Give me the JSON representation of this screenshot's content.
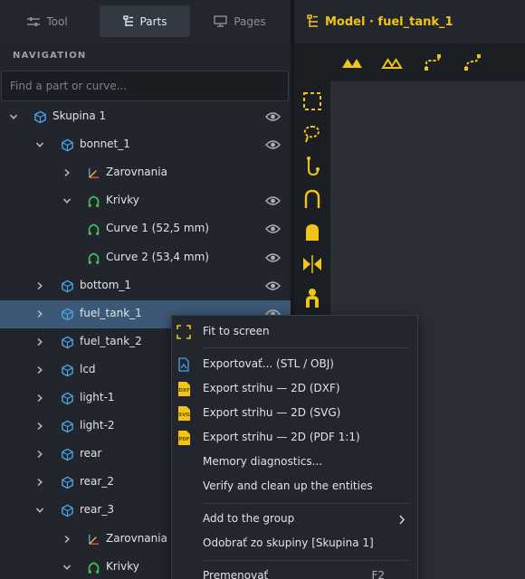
{
  "tabs": [
    {
      "label": "Tool",
      "icon": "sliders-icon"
    },
    {
      "label": "Parts",
      "icon": "list-icon",
      "active": true
    },
    {
      "label": "Pages",
      "icon": "monitor-icon"
    }
  ],
  "navigation": {
    "title": "NAVIGATION",
    "search_placeholder": "Find a part or curve..."
  },
  "tree": [
    {
      "label": "Skupina 1",
      "icon": "part-icon",
      "chevron": "down",
      "eye": true
    },
    {
      "label": "bonnet_1",
      "icon": "part-icon",
      "chevron": "down",
      "eye": true
    },
    {
      "label": "Zarovnania",
      "icon": "axes-icon",
      "chevron": "right",
      "eye": false
    },
    {
      "label": "Krivky",
      "icon": "curve-icon",
      "chevron": "down",
      "eye": true
    },
    {
      "label": "Curve 1  (52,5 mm)",
      "icon": "curve-icon",
      "chevron": "",
      "eye": true
    },
    {
      "label": "Curve 2  (53,4 mm)",
      "icon": "curve-icon",
      "chevron": "",
      "eye": true
    },
    {
      "label": "bottom_1",
      "icon": "part-icon",
      "chevron": "right",
      "eye": true
    },
    {
      "label": "fuel_tank_1",
      "icon": "part-icon",
      "chevron": "right",
      "eye": true,
      "selected": true
    },
    {
      "label": "fuel_tank_2",
      "icon": "part-icon",
      "chevron": "right",
      "eye": false
    },
    {
      "label": "lcd",
      "icon": "part-icon",
      "chevron": "right",
      "eye": false
    },
    {
      "label": "light-1",
      "icon": "part-icon",
      "chevron": "right",
      "eye": false
    },
    {
      "label": "light-2",
      "icon": "part-icon",
      "chevron": "right",
      "eye": false
    },
    {
      "label": "rear",
      "icon": "part-icon",
      "chevron": "right",
      "eye": false
    },
    {
      "label": "rear_2",
      "icon": "part-icon",
      "chevron": "right",
      "eye": false
    },
    {
      "label": "rear_3",
      "icon": "part-icon",
      "chevron": "down",
      "eye": false
    },
    {
      "label": "Zarovnania",
      "icon": "axes-icon",
      "chevron": "right",
      "eye": false
    },
    {
      "label": "Krivky",
      "icon": "curve-icon",
      "chevron": "down",
      "eye": false
    }
  ],
  "model_title": "Model · fuel_tank_1",
  "context_menu": {
    "fit_to_screen": "Fit to screen",
    "export": "Exportovať...  (STL / OBJ)",
    "export_dxf": "Export strihu — 2D  (DXF)",
    "export_svg": "Export strihu — 2D  (SVG)",
    "export_pdf": "Export strihu — 2D  (PDF 1:1)",
    "memory": "Memory diagnostics...",
    "verify": "Verify and clean up the entities",
    "add_group": "Add to the group",
    "remove_group": "Odobrať zo skupiny  [Skupina 1]",
    "rename": "Premenovať",
    "rename_shortcut": "F2",
    "badge_dxf": "DXF",
    "badge_svg": "SVG",
    "badge_pdf": "PDF"
  },
  "colors": {
    "accent": "#f0c419",
    "part": "#4aa3e8",
    "curve": "#3fc25a",
    "selection": "#3b5876"
  }
}
